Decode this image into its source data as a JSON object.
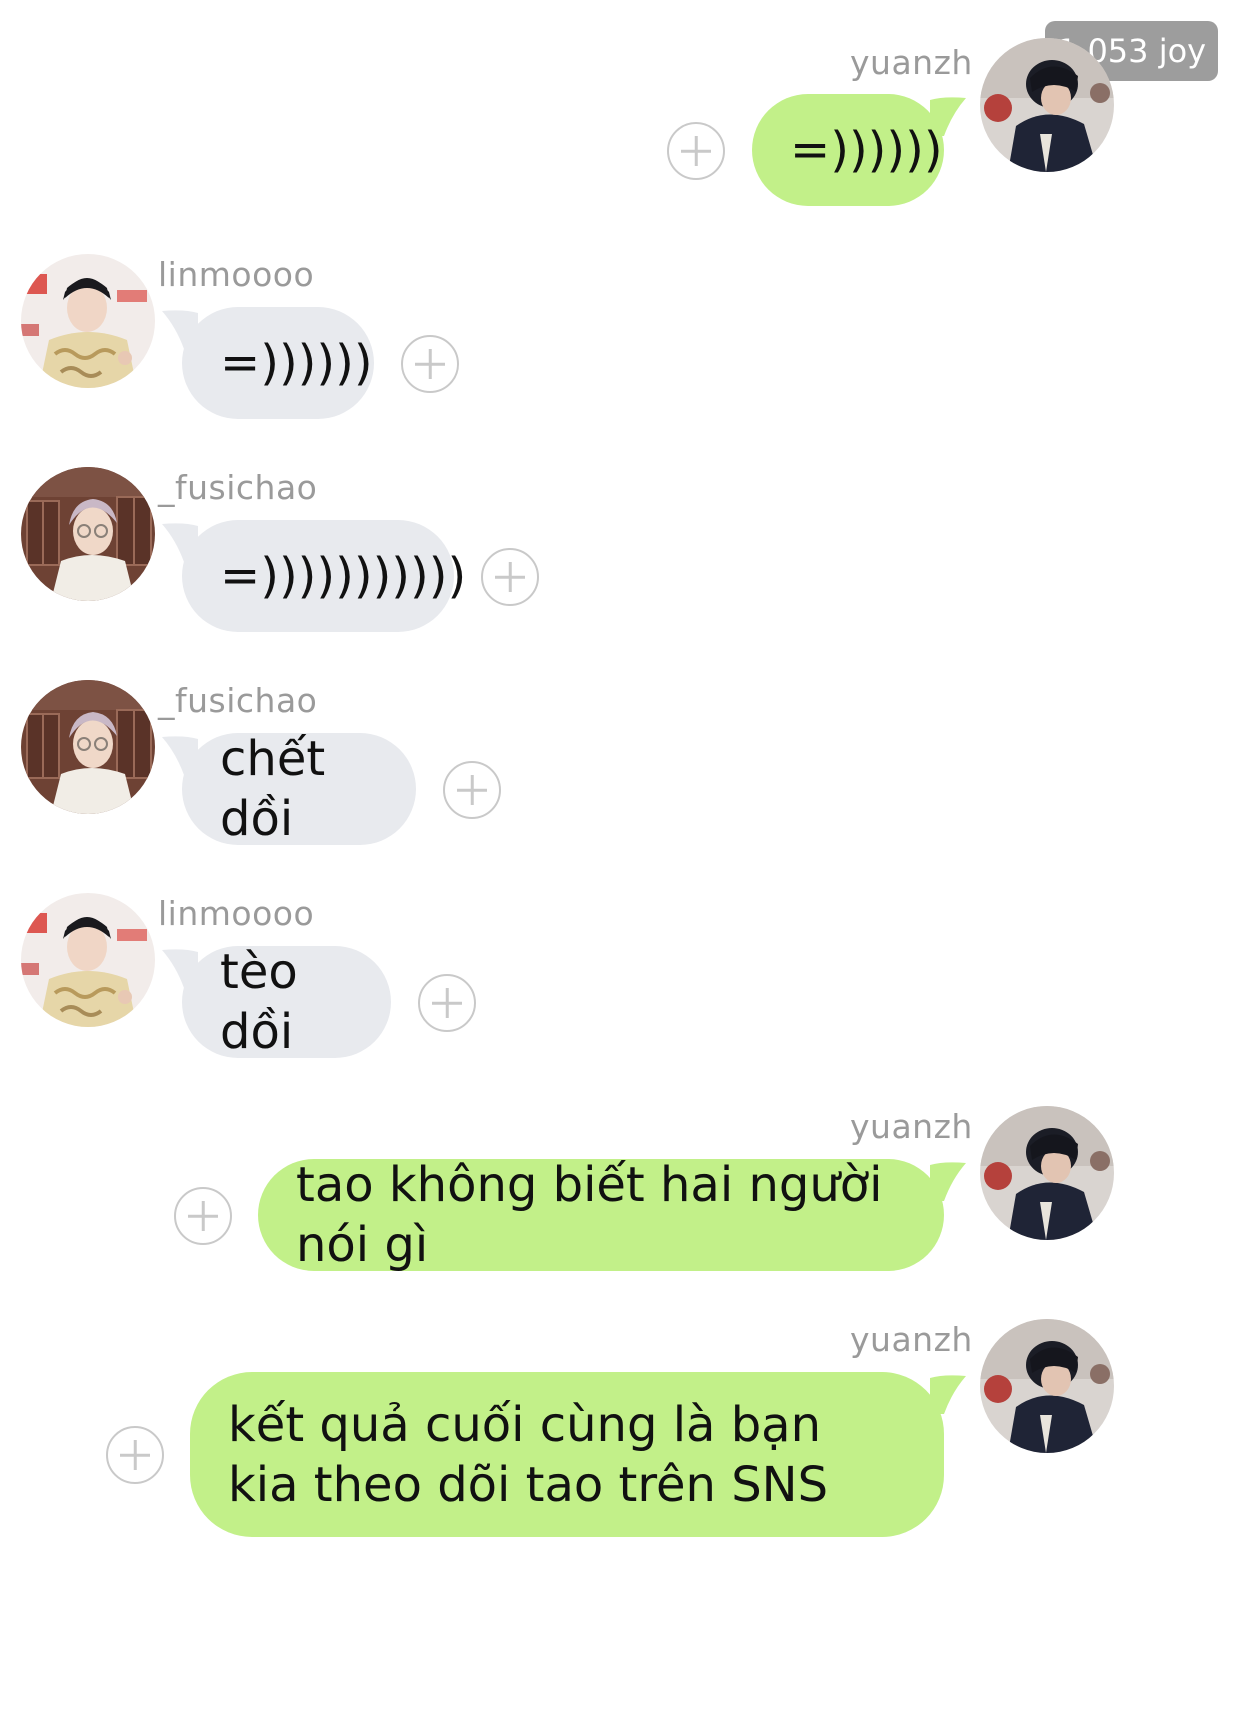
{
  "badge": {
    "text": "1.053 joy"
  },
  "colors": {
    "incoming_bubble": "#e8eaee",
    "outgoing_bubble": "#c2f089",
    "username": "#9a9a9a",
    "plus_icon": "#c9c9c9"
  },
  "messages": [
    {
      "sender": "yuanzh",
      "direction": "outgoing",
      "text": "=))))))"
    },
    {
      "sender": "linmoooo",
      "direction": "incoming",
      "text": "=))))))"
    },
    {
      "sender": "_fusichao",
      "direction": "incoming",
      "text": "=)))))))))))"
    },
    {
      "sender": "_fusichao",
      "direction": "incoming",
      "text": "chết dồi"
    },
    {
      "sender": "linmoooo",
      "direction": "incoming",
      "text": "tèo dồi"
    },
    {
      "sender": "yuanzh",
      "direction": "outgoing",
      "text": "tao không biết hai người nói gì"
    },
    {
      "sender": "yuanzh",
      "direction": "outgoing",
      "text": "kết quả cuối cùng là bạn kia theo dõi tao trên SNS"
    }
  ]
}
